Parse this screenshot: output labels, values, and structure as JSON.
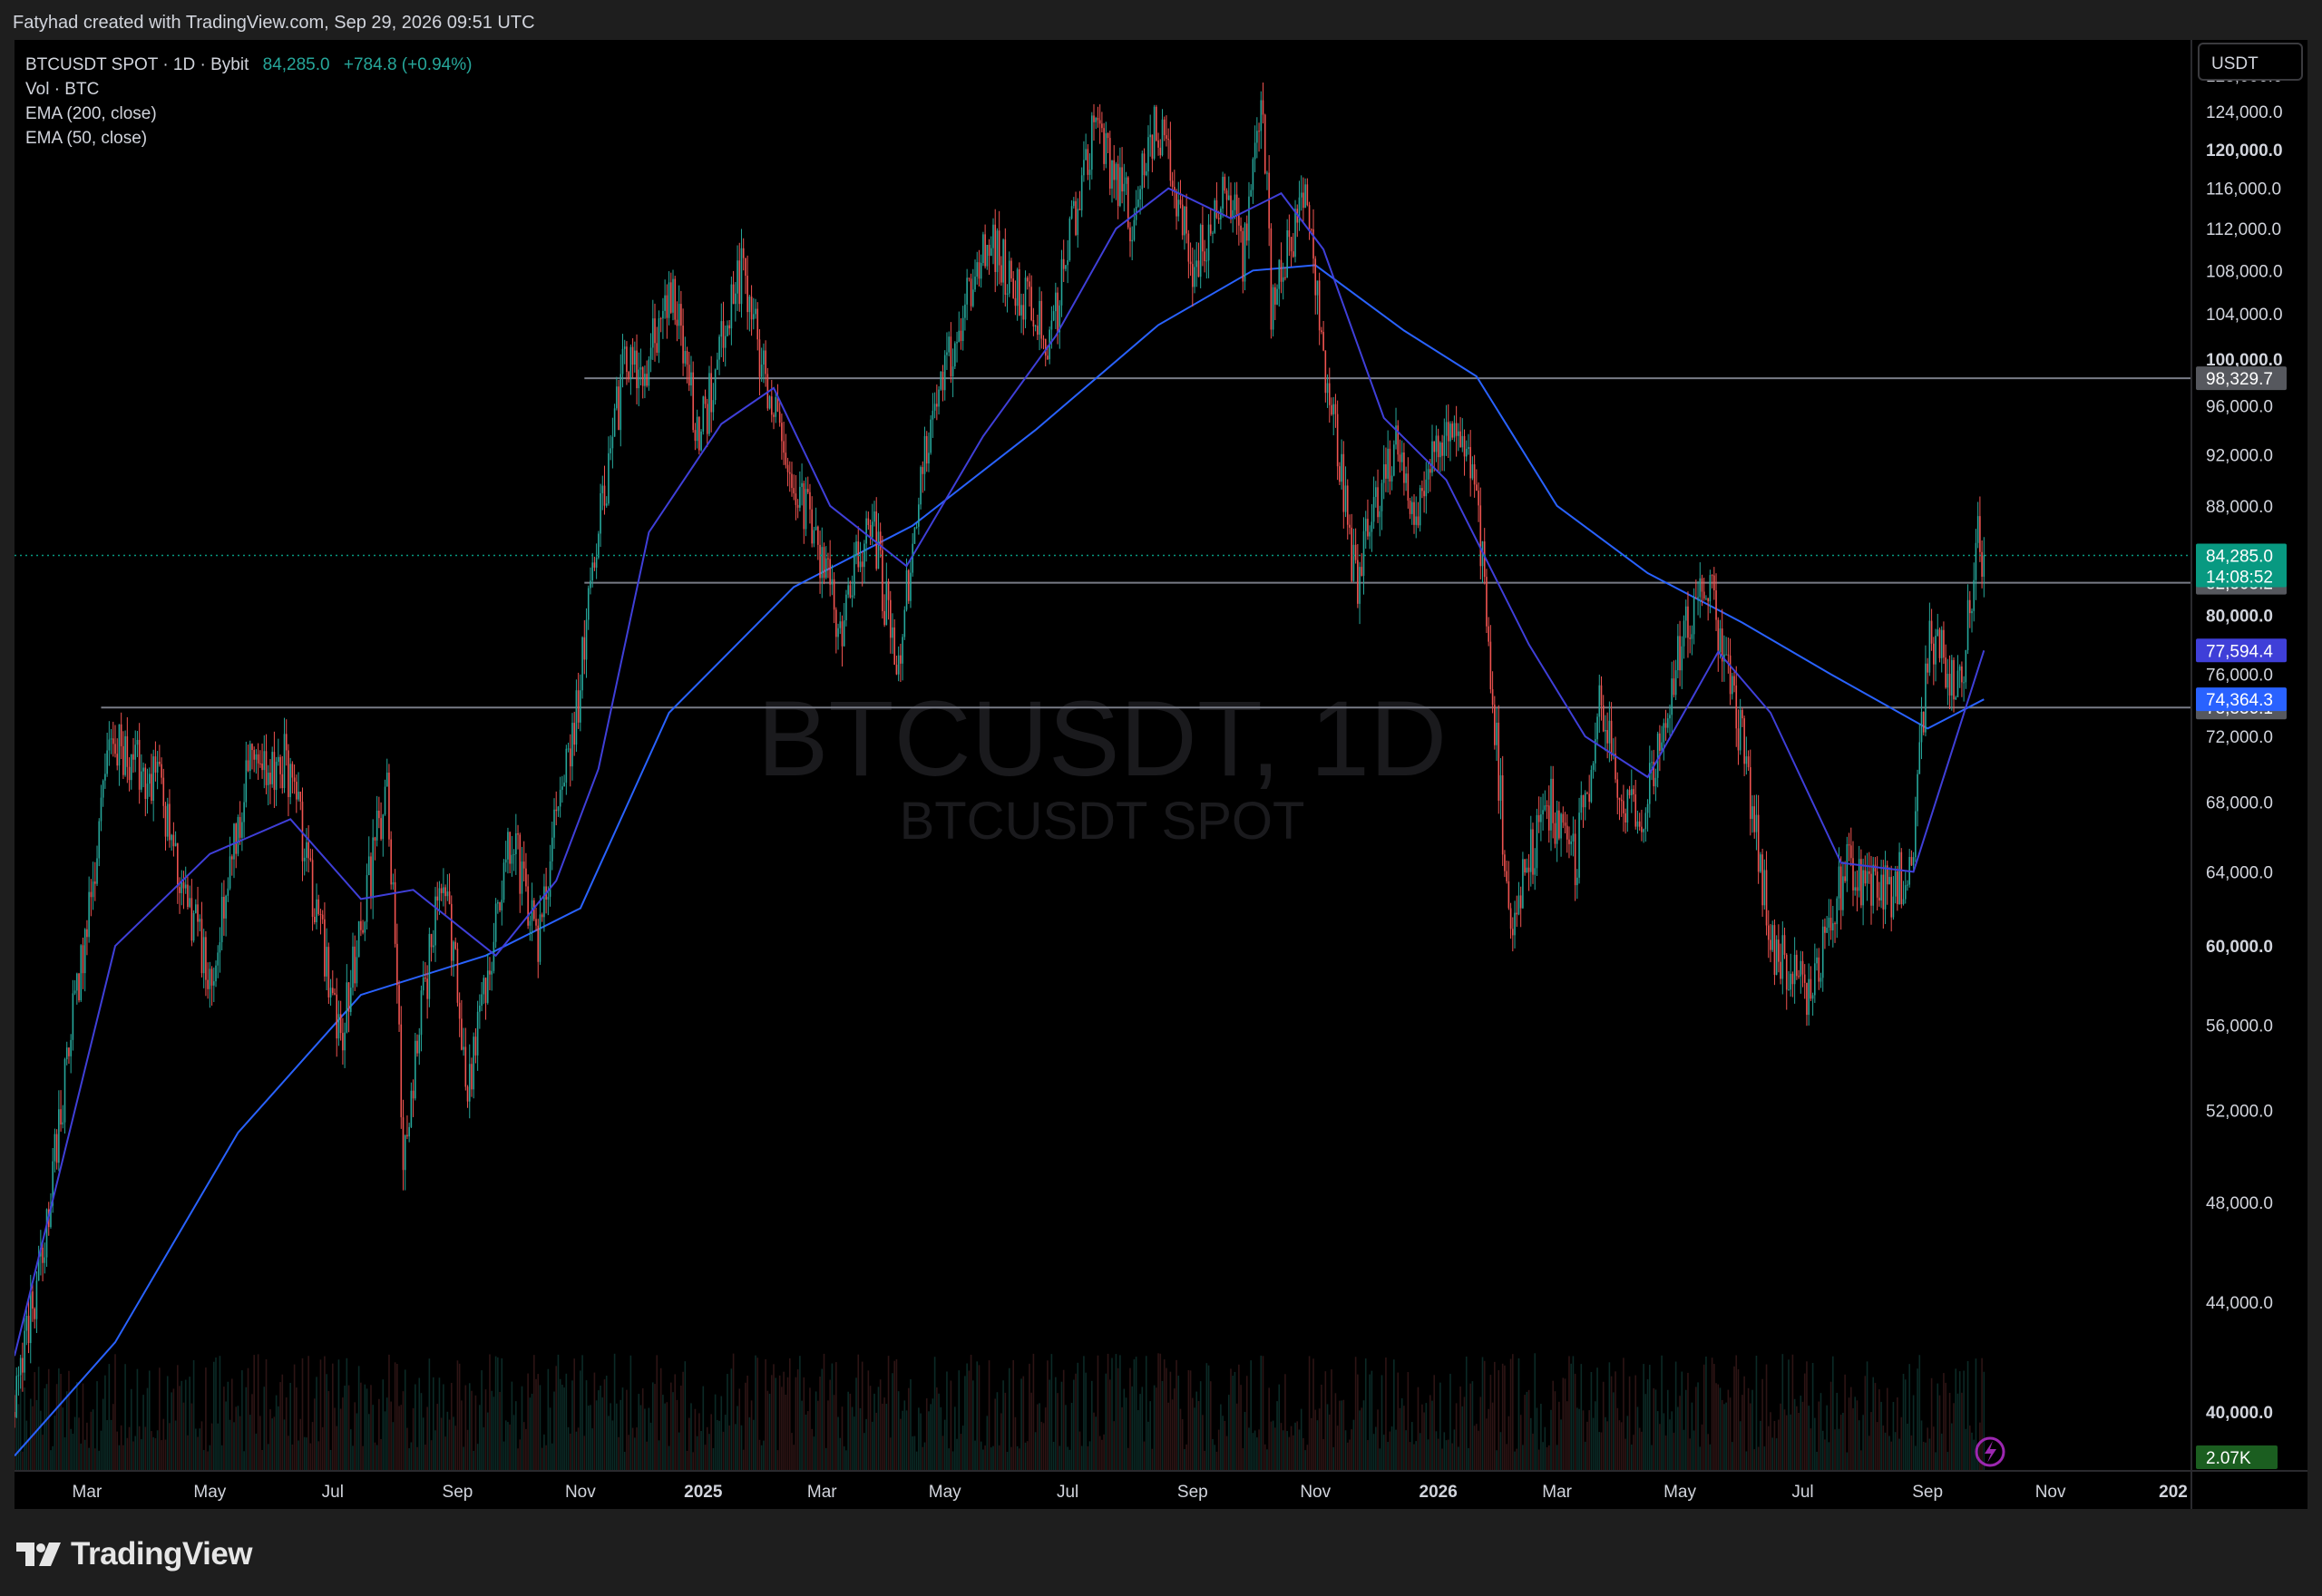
{
  "header": {
    "credit": "Fatyhad created with TradingView.com, Sep 29, 2026 09:51 UTC"
  },
  "legend": {
    "symbol_line": "BTCUSDT SPOT · 1D · Bybit",
    "last_price": "84,285.0",
    "change": "+784.8 (+0.94%)",
    "volume_label": "Vol · BTC",
    "ema200_label": "EMA (200, close)",
    "ema50_label": "EMA (50, close)"
  },
  "watermark": {
    "main": "BTCUSDT, 1D",
    "sub": "BTCUSDT SPOT"
  },
  "price_axis": {
    "currency_button": "USDT"
  },
  "footer": {
    "brand": "TradingView"
  },
  "colors": {
    "up": "#26a69a",
    "down": "#ef5350",
    "ema50": "#3f3fd8",
    "ema200": "#2962ff",
    "background": "#000000",
    "grid_text": "#d1d4dc",
    "hline": "#787b86"
  },
  "chart_data": {
    "type": "candlestick",
    "symbol": "BTCUSDT SPOT",
    "interval": "1D",
    "exchange": "Bybit",
    "y_axis": {
      "scale": "log",
      "range": [
        38000,
        132000
      ],
      "ticks": [
        {
          "value": 128000,
          "label": "128,000.0",
          "bold": false
        },
        {
          "value": 124000,
          "label": "124,000.0",
          "bold": false
        },
        {
          "value": 120000,
          "label": "120,000.0",
          "bold": true
        },
        {
          "value": 116000,
          "label": "116,000.0",
          "bold": false
        },
        {
          "value": 112000,
          "label": "112,000.0",
          "bold": false
        },
        {
          "value": 108000,
          "label": "108,000.0",
          "bold": false
        },
        {
          "value": 104000,
          "label": "104,000.0",
          "bold": false
        },
        {
          "value": 100000,
          "label": "100,000.0",
          "bold": true
        },
        {
          "value": 96000,
          "label": "96,000.0",
          "bold": false
        },
        {
          "value": 92000,
          "label": "92,000.0",
          "bold": false
        },
        {
          "value": 88000,
          "label": "88,000.0",
          "bold": false
        },
        {
          "value": 80000,
          "label": "80,000.0",
          "bold": true
        },
        {
          "value": 76000,
          "label": "76,000.0",
          "bold": false
        },
        {
          "value": 72000,
          "label": "72,000.0",
          "bold": false
        },
        {
          "value": 68000,
          "label": "68,000.0",
          "bold": false
        },
        {
          "value": 64000,
          "label": "64,000.0",
          "bold": false
        },
        {
          "value": 60000,
          "label": "60,000.0",
          "bold": true
        },
        {
          "value": 56000,
          "label": "56,000.0",
          "bold": false
        },
        {
          "value": 52000,
          "label": "52,000.0",
          "bold": false
        },
        {
          "value": 48000,
          "label": "48,000.0",
          "bold": false
        },
        {
          "value": 44000,
          "label": "44,000.0",
          "bold": false
        },
        {
          "value": 40000,
          "label": "40,000.0",
          "bold": true
        }
      ]
    },
    "x_axis": {
      "range": [
        "2024-01-25",
        "2027-01-10"
      ],
      "ticks": [
        {
          "date": "2024-03-01",
          "label": "Mar",
          "bold": false
        },
        {
          "date": "2024-05-01",
          "label": "May",
          "bold": false
        },
        {
          "date": "2024-07-01",
          "label": "Jul",
          "bold": false
        },
        {
          "date": "2024-09-01",
          "label": "Sep",
          "bold": false
        },
        {
          "date": "2024-11-01",
          "label": "Nov",
          "bold": false
        },
        {
          "date": "2025-01-01",
          "label": "2025",
          "bold": true
        },
        {
          "date": "2025-03-01",
          "label": "Mar",
          "bold": false
        },
        {
          "date": "2025-05-01",
          "label": "May",
          "bold": false
        },
        {
          "date": "2025-07-01",
          "label": "Jul",
          "bold": false
        },
        {
          "date": "2025-09-01",
          "label": "Sep",
          "bold": false
        },
        {
          "date": "2025-11-01",
          "label": "Nov",
          "bold": false
        },
        {
          "date": "2026-01-01",
          "label": "2026",
          "bold": true
        },
        {
          "date": "2026-03-01",
          "label": "Mar",
          "bold": false
        },
        {
          "date": "2026-05-01",
          "label": "May",
          "bold": false
        },
        {
          "date": "2026-07-01",
          "label": "Jul",
          "bold": false
        },
        {
          "date": "2026-09-01",
          "label": "Sep",
          "bold": false
        },
        {
          "date": "2026-11-01",
          "label": "Nov",
          "bold": false
        },
        {
          "date": "2027-01-01",
          "label": "202",
          "bold": true
        }
      ]
    },
    "price_path": [
      {
        "date": "2024-01-25",
        "close": 40000
      },
      {
        "date": "2024-02-10",
        "close": 47000
      },
      {
        "date": "2024-02-28",
        "close": 60000
      },
      {
        "date": "2024-03-14",
        "close": 72000
      },
      {
        "date": "2024-04-05",
        "close": 69000
      },
      {
        "date": "2024-05-01",
        "close": 58000
      },
      {
        "date": "2024-05-20",
        "close": 70000
      },
      {
        "date": "2024-06-08",
        "close": 70500
      },
      {
        "date": "2024-07-05",
        "close": 55000
      },
      {
        "date": "2024-07-28",
        "close": 69000
      },
      {
        "date": "2024-08-05",
        "close": 50000
      },
      {
        "date": "2024-08-25",
        "close": 64500
      },
      {
        "date": "2024-09-06",
        "close": 53000
      },
      {
        "date": "2024-09-28",
        "close": 66000
      },
      {
        "date": "2024-10-10",
        "close": 60000
      },
      {
        "date": "2024-10-29",
        "close": 72500
      },
      {
        "date": "2024-11-12",
        "close": 88000
      },
      {
        "date": "2024-11-22",
        "close": 98500
      },
      {
        "date": "2024-12-05",
        "close": 100000
      },
      {
        "date": "2024-12-17",
        "close": 107000
      },
      {
        "date": "2024-12-30",
        "close": 93000
      },
      {
        "date": "2025-01-20",
        "close": 108000
      },
      {
        "date": "2025-02-03",
        "close": 97000
      },
      {
        "date": "2025-03-10",
        "close": 79000
      },
      {
        "date": "2025-03-25",
        "close": 87500
      },
      {
        "date": "2025-04-07",
        "close": 76000
      },
      {
        "date": "2025-04-22",
        "close": 93500
      },
      {
        "date": "2025-05-22",
        "close": 111000
      },
      {
        "date": "2025-06-22",
        "close": 101000
      },
      {
        "date": "2025-07-14",
        "close": 122000
      },
      {
        "date": "2025-08-02",
        "close": 113000
      },
      {
        "date": "2025-08-14",
        "close": 123500
      },
      {
        "date": "2025-09-01",
        "close": 108000
      },
      {
        "date": "2025-09-18",
        "close": 117000
      },
      {
        "date": "2025-09-26",
        "close": 109000
      },
      {
        "date": "2025-10-06",
        "close": 125500
      },
      {
        "date": "2025-10-10",
        "close": 104000
      },
      {
        "date": "2025-10-27",
        "close": 116000
      },
      {
        "date": "2025-11-04",
        "close": 101000
      },
      {
        "date": "2025-11-21",
        "close": 82000
      },
      {
        "date": "2025-12-10",
        "close": 93000
      },
      {
        "date": "2025-12-20",
        "close": 86000
      },
      {
        "date": "2026-01-05",
        "close": 95000
      },
      {
        "date": "2026-01-20",
        "close": 89000
      },
      {
        "date": "2026-02-05",
        "close": 61000
      },
      {
        "date": "2026-02-25",
        "close": 68000
      },
      {
        "date": "2026-03-10",
        "close": 64500
      },
      {
        "date": "2026-03-22",
        "close": 73500
      },
      {
        "date": "2026-04-10",
        "close": 66000
      },
      {
        "date": "2026-05-06",
        "close": 80000
      },
      {
        "date": "2026-05-15",
        "close": 82500
      },
      {
        "date": "2026-06-02",
        "close": 71000
      },
      {
        "date": "2026-06-15",
        "close": 60000
      },
      {
        "date": "2026-07-05",
        "close": 57500
      },
      {
        "date": "2026-07-22",
        "close": 64000
      },
      {
        "date": "2026-08-15",
        "close": 63000
      },
      {
        "date": "2026-08-25",
        "close": 65000
      },
      {
        "date": "2026-09-02",
        "close": 79000
      },
      {
        "date": "2026-09-12",
        "close": 76000
      },
      {
        "date": "2026-09-18",
        "close": 75500
      },
      {
        "date": "2026-09-24",
        "close": 83000
      },
      {
        "date": "2026-09-25",
        "close": 86500
      },
      {
        "date": "2026-09-29",
        "close": 84285
      }
    ],
    "ema50": [
      {
        "date": "2024-01-25",
        "value": 42000
      },
      {
        "date": "2024-03-15",
        "value": 60000
      },
      {
        "date": "2024-05-01",
        "value": 65000
      },
      {
        "date": "2024-06-10",
        "value": 67000
      },
      {
        "date": "2024-07-15",
        "value": 62500
      },
      {
        "date": "2024-08-10",
        "value": 63000
      },
      {
        "date": "2024-09-20",
        "value": 59500
      },
      {
        "date": "2024-10-20",
        "value": 63500
      },
      {
        "date": "2024-11-10",
        "value": 70000
      },
      {
        "date": "2024-12-05",
        "value": 86000
      },
      {
        "date": "2025-01-10",
        "value": 94500
      },
      {
        "date": "2025-02-05",
        "value": 97500
      },
      {
        "date": "2025-03-05",
        "value": 88000
      },
      {
        "date": "2025-04-12",
        "value": 83500
      },
      {
        "date": "2025-05-20",
        "value": 93500
      },
      {
        "date": "2025-06-25",
        "value": 102000
      },
      {
        "date": "2025-07-25",
        "value": 112000
      },
      {
        "date": "2025-08-20",
        "value": 116000
      },
      {
        "date": "2025-09-20",
        "value": 113000
      },
      {
        "date": "2025-10-15",
        "value": 115500
      },
      {
        "date": "2025-11-05",
        "value": 110000
      },
      {
        "date": "2025-12-05",
        "value": 95000
      },
      {
        "date": "2026-01-05",
        "value": 90000
      },
      {
        "date": "2026-02-15",
        "value": 78000
      },
      {
        "date": "2026-03-15",
        "value": 72000
      },
      {
        "date": "2026-04-15",
        "value": 69500
      },
      {
        "date": "2026-05-20",
        "value": 77500
      },
      {
        "date": "2026-06-15",
        "value": 73500
      },
      {
        "date": "2026-07-20",
        "value": 64500
      },
      {
        "date": "2026-08-25",
        "value": 64000
      },
      {
        "date": "2026-09-29",
        "value": 77594.4
      }
    ],
    "ema200": [
      {
        "date": "2024-01-25",
        "value": 38500
      },
      {
        "date": "2024-03-15",
        "value": 42500
      },
      {
        "date": "2024-05-15",
        "value": 51000
      },
      {
        "date": "2024-07-15",
        "value": 57500
      },
      {
        "date": "2024-09-15",
        "value": 59500
      },
      {
        "date": "2024-11-01",
        "value": 62000
      },
      {
        "date": "2024-12-15",
        "value": 73500
      },
      {
        "date": "2025-02-15",
        "value": 82000
      },
      {
        "date": "2025-04-15",
        "value": 86500
      },
      {
        "date": "2025-06-15",
        "value": 94000
      },
      {
        "date": "2025-08-15",
        "value": 103000
      },
      {
        "date": "2025-10-01",
        "value": 108000
      },
      {
        "date": "2025-11-01",
        "value": 108500
      },
      {
        "date": "2025-12-15",
        "value": 102500
      },
      {
        "date": "2026-01-20",
        "value": 98500
      },
      {
        "date": "2026-03-01",
        "value": 88000
      },
      {
        "date": "2026-04-15",
        "value": 83000
      },
      {
        "date": "2026-06-01",
        "value": 79500
      },
      {
        "date": "2026-07-15",
        "value": 76000
      },
      {
        "date": "2026-09-01",
        "value": 72500
      },
      {
        "date": "2026-09-29",
        "value": 74364.3
      }
    ],
    "horizontal_lines": [
      {
        "price": 98329.7,
        "label": "98,329.7",
        "start": "2024-11-03"
      },
      {
        "price": 82303.2,
        "label": "82,303.2",
        "start": "2024-11-03"
      },
      {
        "price": 73836.1,
        "label": "73,836.1",
        "start": "2024-03-08"
      }
    ],
    "price_labels": [
      {
        "price": 84285.0,
        "label": "84,285.0",
        "countdown": "14:08:52",
        "color": "#089981"
      },
      {
        "price": 77594.4,
        "label": "77,594.4",
        "color": "#3f3fd8"
      },
      {
        "price": 74364.3,
        "label": "74,364.3",
        "color": "#2962ff"
      }
    ],
    "volume_label": "2.07K"
  }
}
